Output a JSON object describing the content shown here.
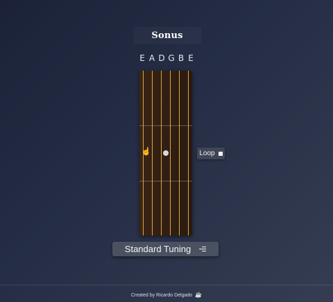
{
  "app": {
    "title": "Sonus"
  },
  "strings": [
    "E",
    "A",
    "D",
    "G",
    "B",
    "E"
  ],
  "controls": {
    "loop_label": "Loop",
    "tuning_label": "Standard Tuning"
  },
  "footer": {
    "credit": "Created by Ricardo Delgado"
  },
  "icons": {
    "loop": "stop-square-icon",
    "tuning": "menu-lines-icon",
    "footer": "coffee-icon",
    "cursor": "hand-pointer-icon"
  },
  "colors": {
    "string": "#d7a84a",
    "fretboard": "#2e1d11",
    "button": "#4a5160"
  }
}
